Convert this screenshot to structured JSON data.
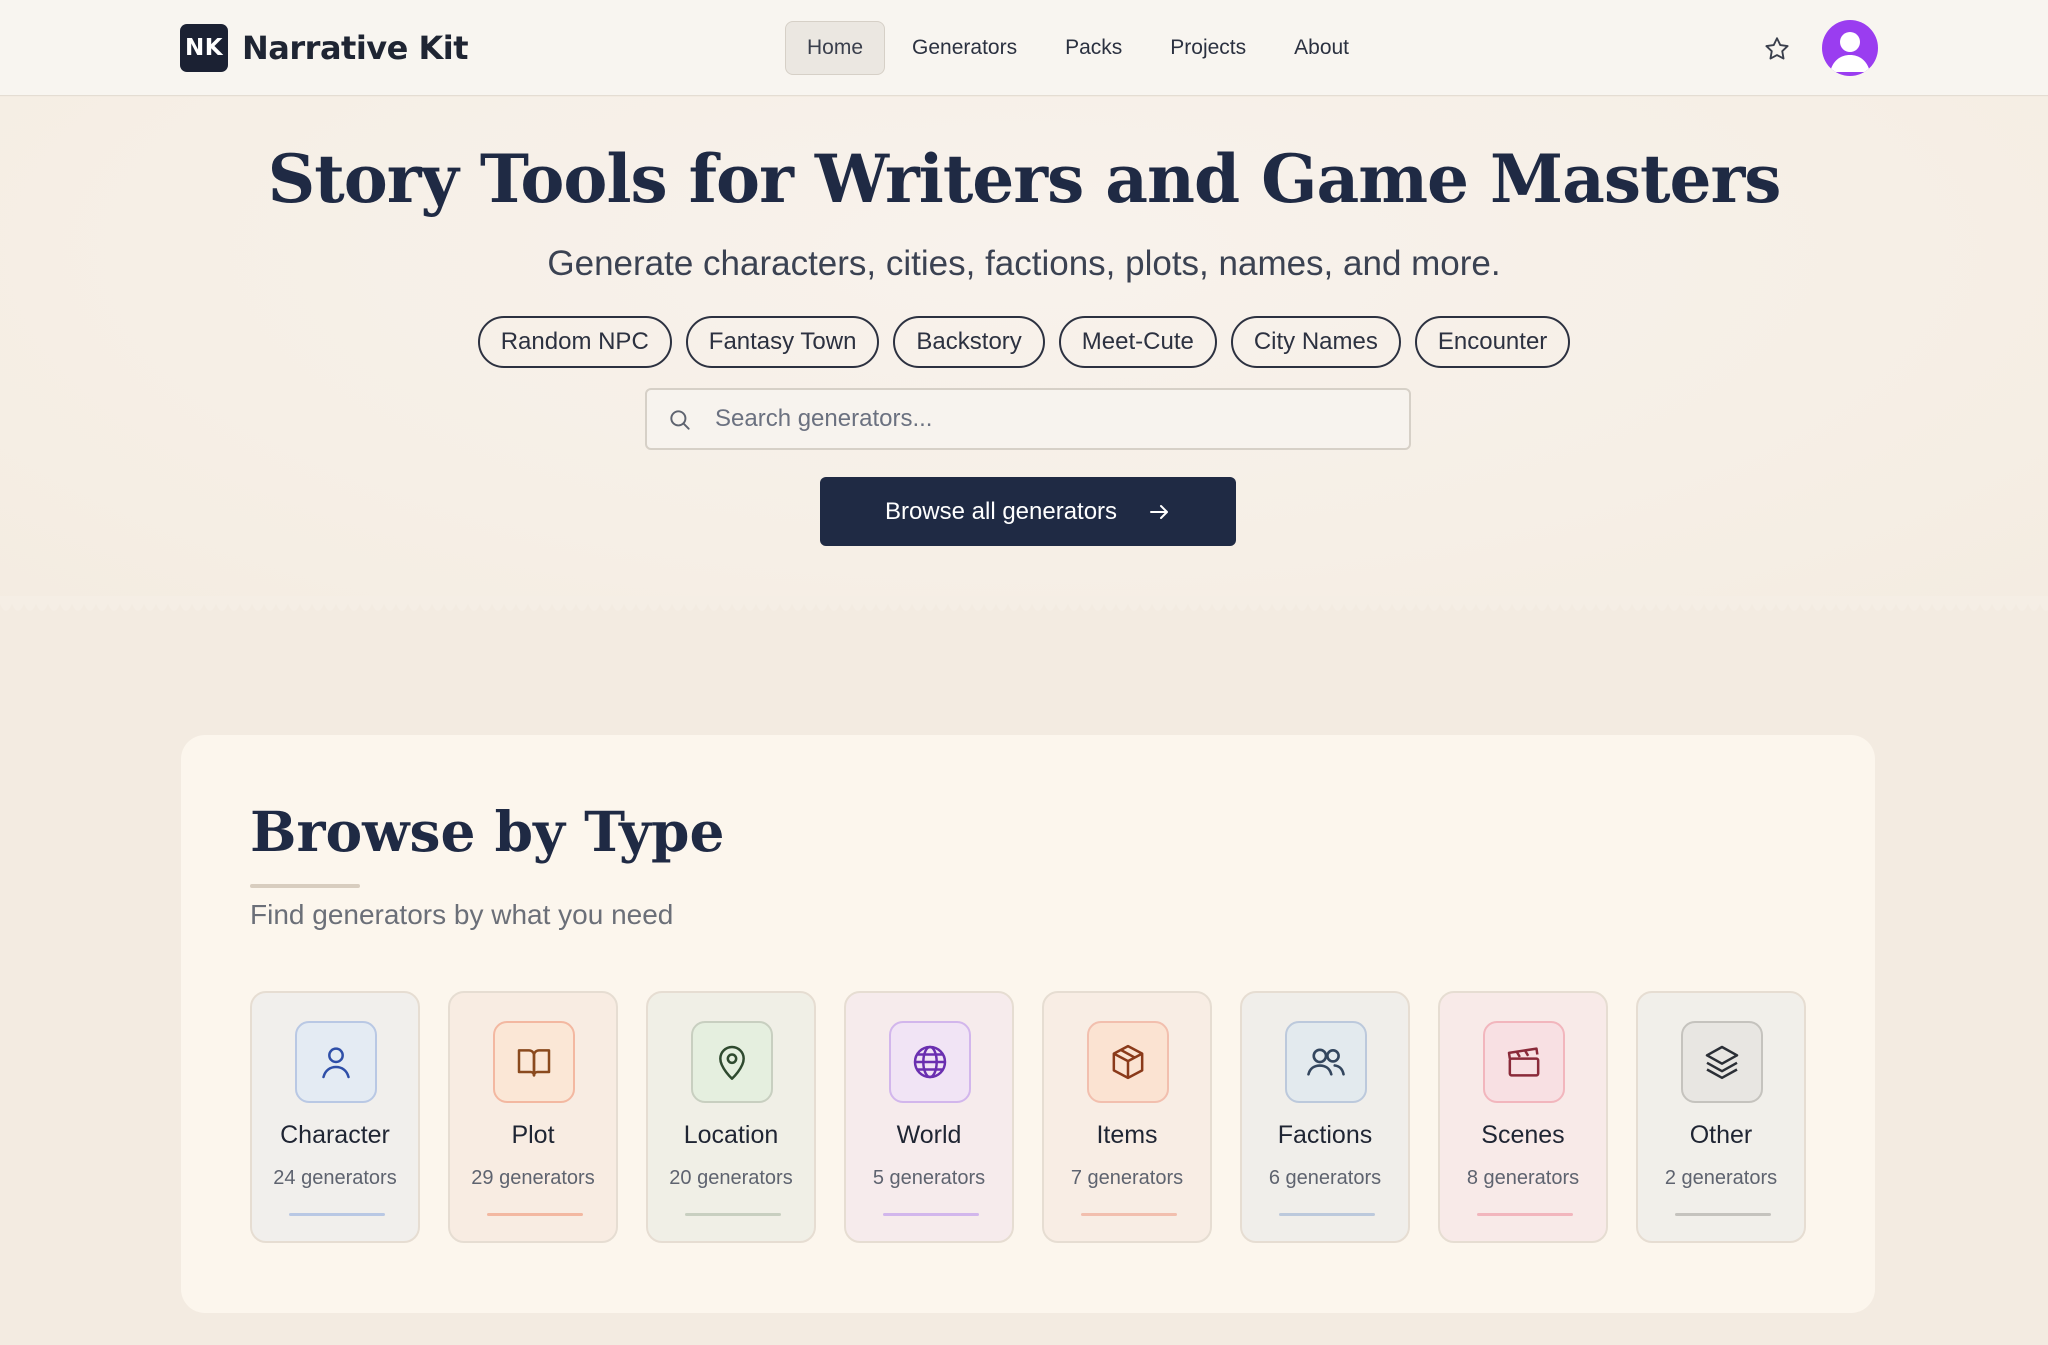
{
  "brand": {
    "mark": "NK",
    "name": "Narrative Kit"
  },
  "nav": {
    "items": [
      {
        "label": "Home",
        "active": true
      },
      {
        "label": "Generators",
        "active": false
      },
      {
        "label": "Packs",
        "active": false
      },
      {
        "label": "Projects",
        "active": false
      },
      {
        "label": "About",
        "active": false
      }
    ],
    "favorites_icon": "star-icon",
    "avatar_icon": "user-avatar-icon"
  },
  "hero": {
    "title": "Story Tools for Writers and Game Masters",
    "subtitle": "Generate characters, cities, factions, plots, names, and more.",
    "chips": [
      "Random NPC",
      "Fantasy Town",
      "Backstory",
      "Meet-Cute",
      "City Names",
      "Encounter"
    ],
    "search_placeholder": "Search generators...",
    "search_value": "",
    "cta_label": "Browse all generators"
  },
  "browse": {
    "title": "Browse by Type",
    "subtitle": "Find generators by what you need",
    "types": [
      {
        "name": "Character",
        "count": "24 generators",
        "icon": "user-icon",
        "color": "#2f4fa8",
        "tint": "#e4ebf3",
        "card": "#f1efec",
        "bar": "#b9c8e4"
      },
      {
        "name": "Plot",
        "count": "29 generators",
        "icon": "book-icon",
        "color": "#8a4a1e",
        "tint": "#fbe7d6",
        "card": "#f8ece2",
        "bar": "#f3b8a1"
      },
      {
        "name": "Location",
        "count": "20 generators",
        "icon": "map-pin-icon",
        "color": "#2f4a2f",
        "tint": "#e5efdf",
        "card": "#f0efe6",
        "bar": "#c8cfc0"
      },
      {
        "name": "World",
        "count": "5 generators",
        "icon": "globe-icon",
        "color": "#6a2fb0",
        "tint": "#f1e4f5",
        "card": "#f6ebec",
        "bar": "#d2b6ec"
      },
      {
        "name": "Items",
        "count": "7 generators",
        "icon": "box-icon",
        "color": "#8a3a1a",
        "tint": "#fbe3d2",
        "card": "#f8ede4",
        "bar": "#f2bfae"
      },
      {
        "name": "Factions",
        "count": "6 generators",
        "icon": "users-icon",
        "color": "#33465e",
        "tint": "#e3eaee",
        "card": "#f0eeea",
        "bar": "#bcc9dc"
      },
      {
        "name": "Scenes",
        "count": "8 generators",
        "icon": "clapperboard-icon",
        "color": "#8a2a3a",
        "tint": "#f8e0e3",
        "card": "#f8eae8",
        "bar": "#f2b6bd"
      },
      {
        "name": "Other",
        "count": "2 generators",
        "icon": "layers-icon",
        "color": "#2b2f36",
        "tint": "#e8e6e2",
        "card": "#f1efea",
        "bar": "#c5c3be"
      }
    ]
  }
}
